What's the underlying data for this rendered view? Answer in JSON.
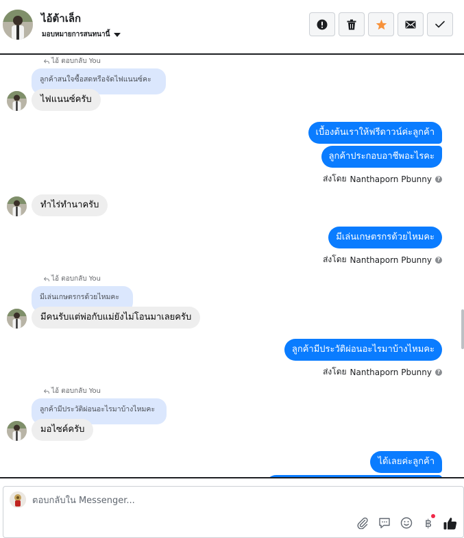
{
  "header": {
    "contact_name": "ไอ้ต้าเล็ก",
    "assign_label": "มอบหมายการสนทนานี้",
    "actions": [
      "mark-spam",
      "delete",
      "star",
      "mark-unread",
      "done"
    ]
  },
  "thread": {
    "messages": [
      {
        "id": 1,
        "replied_label": "ไอ้ ตอบกลับ You",
        "quoted": "ลูกค้าสนใจซื้อสดหรือจัดไฟแนนซ์คะ",
        "text": "ไฟแนนซ์ครับ"
      },
      {
        "id": 2,
        "text": "เบื้องต้นเราให้ฟรีดาวน์ค่ะลูกค้า"
      },
      {
        "id": 3,
        "text": "ลูกค้าประกอบอาชีพอะไรคะ"
      },
      {
        "id": 4,
        "text": "ทำไร่ทำนาครับ"
      },
      {
        "id": 5,
        "text": "มีเล่นเกษตรกรด้วยไหมคะ"
      },
      {
        "id": 6,
        "replied_label": "ไอ้ ตอบกลับ You",
        "quoted": "มีเล่นเกษตรกรด้วยไหมคะ",
        "text": "มีคนรับแต่พ่อกับแม่ยังไม่โอนมาเลยครับ"
      },
      {
        "id": 7,
        "text": "ลูกค้ามีประวัติผ่อนอะไรมาบ้างไหมคะ"
      },
      {
        "id": 8,
        "replied_label": "ไอ้ ตอบกลับ You",
        "quoted": "ลูกค้ามีประวัติผ่อนอะไรมาบ้างไหมคะ",
        "text": "มอไซค์ครับ"
      },
      {
        "id": 9,
        "text": "ได้เลยค่ะลูกค้า"
      }
    ],
    "sent_by_prefix": "ส่งโดย",
    "sent_by_name": "Nanthaporn Pbunny"
  },
  "composer": {
    "placeholder": "ตอบกลับใน Messenger...",
    "icons": [
      "paperclip-icon",
      "saved-reply-icon",
      "emoji-icon",
      "baht-payment-icon",
      "thumbs-up-icon"
    ]
  },
  "colors": {
    "outgoing_bubble": "#0a7cff",
    "incoming_bubble": "#eeeeee",
    "quoted_bubble": "#dbe7fd",
    "star": "#f7923b",
    "notification_dot": "#f02849"
  }
}
